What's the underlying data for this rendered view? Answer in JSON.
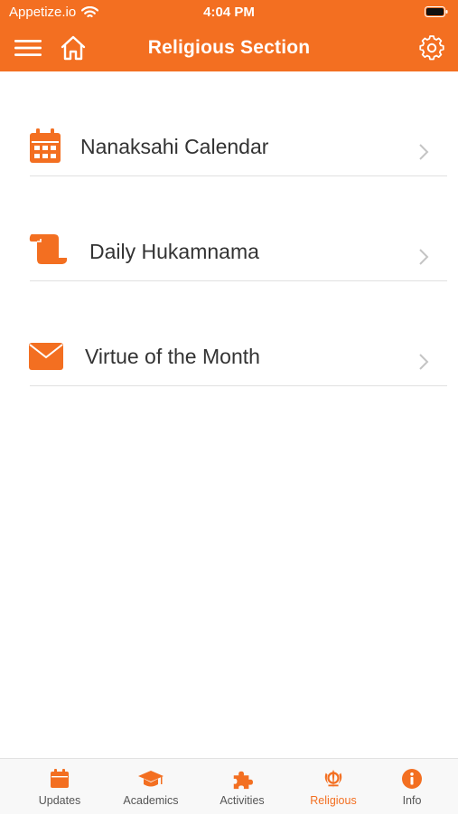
{
  "status_bar": {
    "carrier": "Appetize.io",
    "time": "4:04 PM"
  },
  "header": {
    "title": "Religious Section"
  },
  "menu": {
    "items": [
      {
        "label": "Nanaksahi Calendar",
        "icon": "calendar-icon"
      },
      {
        "label": "Daily Hukamnama",
        "icon": "scroll-icon"
      },
      {
        "label": "Virtue of the Month",
        "icon": "envelope-icon"
      }
    ]
  },
  "tabs": {
    "items": [
      {
        "label": "Updates",
        "icon": "calendar-icon"
      },
      {
        "label": "Academics",
        "icon": "graduation-cap-icon"
      },
      {
        "label": "Activities",
        "icon": "puzzle-icon"
      },
      {
        "label": "Religious",
        "icon": "khanda-icon"
      },
      {
        "label": "Info",
        "icon": "info-icon"
      }
    ],
    "active": "Religious"
  },
  "colors": {
    "accent": "#f36f21",
    "tab_inactive_text": "#555555",
    "row_text": "#333333",
    "chevron": "#c4c4c4"
  }
}
